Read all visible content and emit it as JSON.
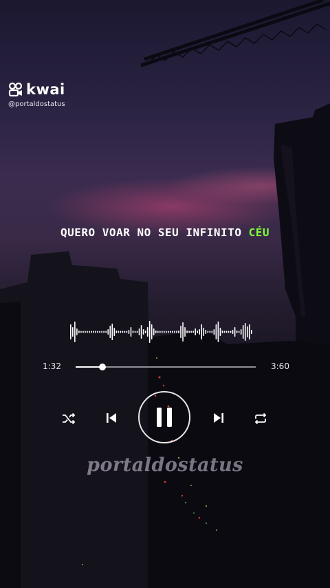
{
  "brand": {
    "name": "kwai",
    "handle": "@portaldostatus"
  },
  "lyric": {
    "main": "QUERO VOAR NO SEU INFINITO",
    "highlight": "CÉU",
    "highlight_color": "#7dff3a"
  },
  "player": {
    "elapsed": "1:32",
    "duration": "3:60",
    "progress_fraction": 0.15,
    "controls": [
      "shuffle-icon",
      "previous-icon",
      "pause-icon",
      "next-icon",
      "repeat-icon"
    ]
  },
  "watermark": "portaldostatus"
}
